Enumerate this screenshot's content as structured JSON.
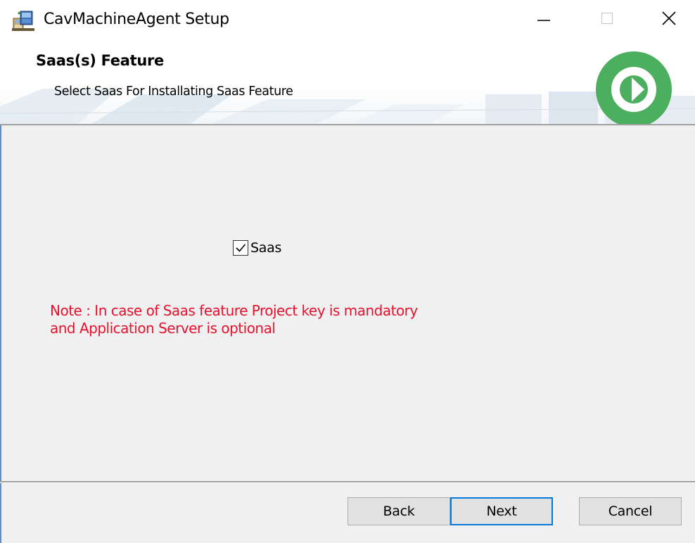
{
  "window": {
    "title": "CavMachineAgent Setup",
    "icon": "installer-icon",
    "controls": {
      "minimize": "minimize-icon",
      "maximize": "maximize-icon",
      "close": "close-icon"
    }
  },
  "banner": {
    "title": "Saas(s) Feature",
    "subtitle": "Select Saas For Installating Saas Feature",
    "logo": "cavisson-logo",
    "logo_color": "#4cae5f"
  },
  "content": {
    "checkbox": {
      "label": "Saas",
      "checked": true
    },
    "note_line1": "Note : In case of Saas feature Project key is mandatory",
    "note_line2": "and Application Server is optional",
    "note_color": "#e8112d"
  },
  "buttons": {
    "back": "Back",
    "next": "Next",
    "cancel": "Cancel"
  },
  "colors": {
    "accent": "#0078d7",
    "window_bg": "#f0f0f0"
  }
}
